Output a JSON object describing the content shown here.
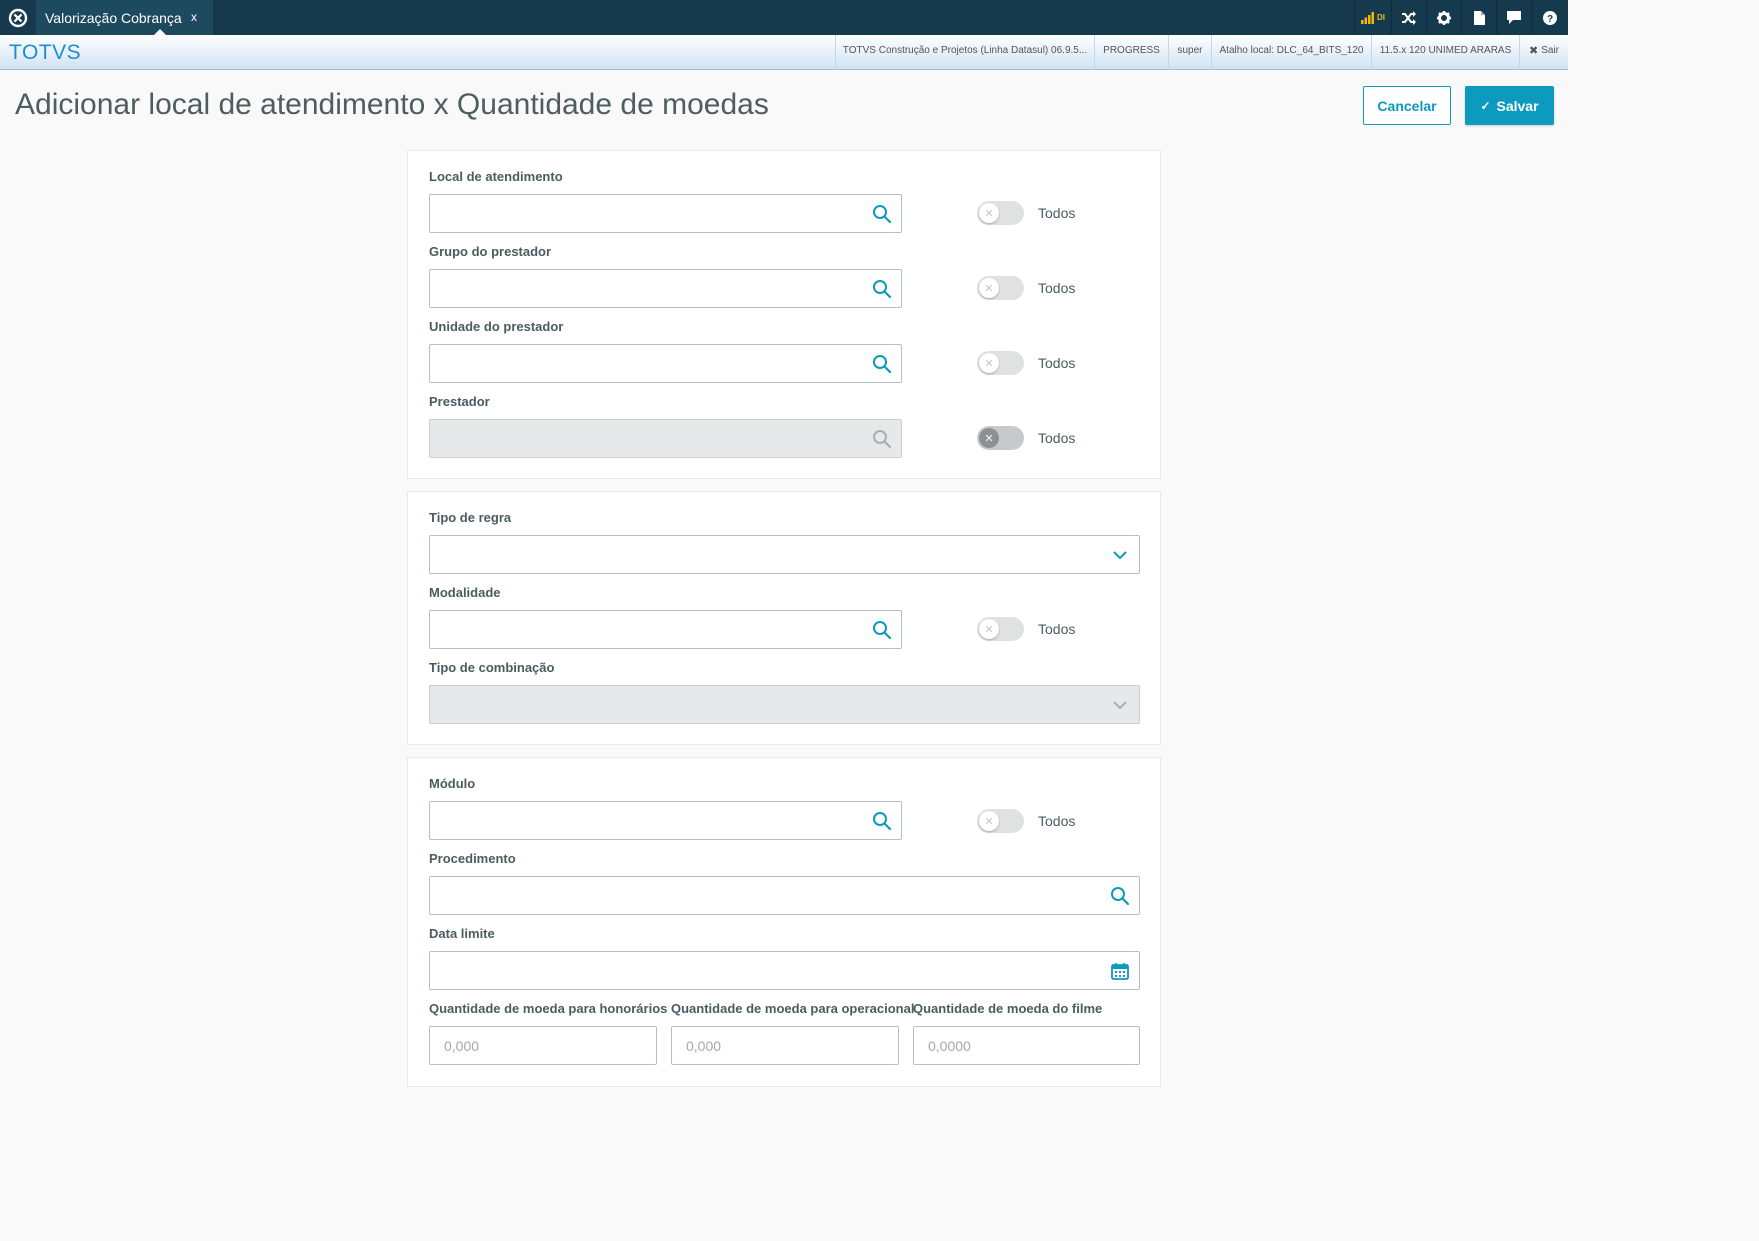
{
  "topbar": {
    "tab_label": "Valorização Cobrança",
    "tab_close": "x",
    "signal_text": "DI",
    "icons": [
      "signal-icon",
      "shuffle-icon",
      "gear-icon",
      "document-icon",
      "chat-icon",
      "help-icon"
    ]
  },
  "header": {
    "brand": "TOTVS",
    "info": [
      "TOTVS Construção e Projetos (Linha Datasul) 06.9.5...",
      "PROGRESS",
      "super",
      "Atalho local: DLC_64_BITS_120",
      "11.5.x 120 UNIMED ARARAS"
    ],
    "logout": "Sair"
  },
  "page": {
    "title": "Adicionar local de atendimento x Quantidade de moedas",
    "cancel_label": "Cancelar",
    "save_label": "Salvar"
  },
  "card1": {
    "local": {
      "label": "Local de atendimento",
      "toggle_label": "Todos"
    },
    "grupo": {
      "label": "Grupo do prestador",
      "toggle_label": "Todos"
    },
    "unidade": {
      "label": "Unidade do prestador",
      "toggle_label": "Todos"
    },
    "prestador": {
      "label": "Prestador",
      "toggle_label": "Todos"
    }
  },
  "card2": {
    "tipo_regra": {
      "label": "Tipo de regra"
    },
    "modalidade": {
      "label": "Modalidade",
      "toggle_label": "Todos"
    },
    "tipo_combinacao": {
      "label": "Tipo de combinação"
    }
  },
  "card3": {
    "modulo": {
      "label": "Módulo",
      "toggle_label": "Todos"
    },
    "procedimento": {
      "label": "Procedimento"
    },
    "data_limite": {
      "label": "Data limite"
    },
    "qtd_honorarios": {
      "label": "Quantidade de moeda para honorários",
      "placeholder": "0,000"
    },
    "qtd_operacional": {
      "label": "Quantidade de moeda para operacional",
      "placeholder": "0,000"
    },
    "qtd_filme": {
      "label": "Quantidade de moeda do filme",
      "placeholder": "0,0000"
    }
  },
  "colors": {
    "accent": "#0c9abe",
    "topbar": "#163a4d",
    "brand": "#1d8dd1"
  }
}
